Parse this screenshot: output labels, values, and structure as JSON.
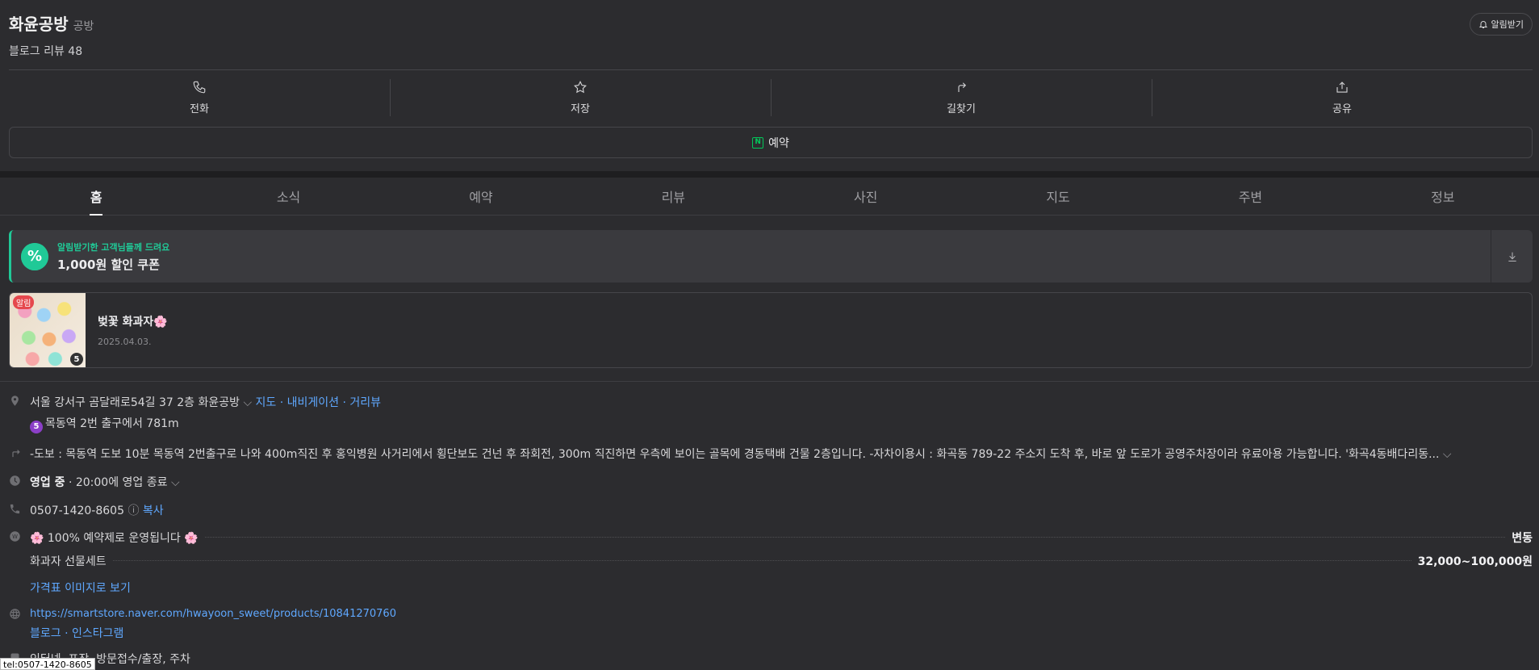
{
  "place": {
    "name": "화윤공방",
    "category": "공방",
    "blog_review": "블로그 리뷰 48",
    "alarm_label": "알림받기"
  },
  "actions": [
    {
      "label": "전화",
      "icon": "phone-icon"
    },
    {
      "label": "저장",
      "icon": "star-icon"
    },
    {
      "label": "길찾기",
      "icon": "directions-icon"
    },
    {
      "label": "공유",
      "icon": "share-icon"
    }
  ],
  "reserve_label": "예약",
  "npay_badge": "N",
  "tabs": [
    "홈",
    "소식",
    "예약",
    "리뷰",
    "사진",
    "지도",
    "주변",
    "정보"
  ],
  "coupon": {
    "sub": "알림받기한 고객님들께 드려요",
    "main": "1,000원 할인 쿠폰",
    "badge": "%"
  },
  "news": {
    "label": "알림",
    "count": "5",
    "title": "벚꽃 화과자🌸",
    "date": "2025.04.03."
  },
  "info": {
    "address": "서울 강서구 곰달래로54길 37 2층 화윤공방",
    "address_links": [
      "지도",
      "내비게이션",
      "거리뷰"
    ],
    "subway_line": "5",
    "subway_text": "목동역 2번 출구에서 781m",
    "directions": "-도보 : 목동역 도보 10분 목동역 2번출구로 나와 400m직진 후 홍익병원 사거리에서 횡단보도 건넌 후 좌회전, 300m 직진하면 우측에 보이는 골목에 경동택배 건물 2층입니다. -자차이용시 : 화곡동 789-22 주소지 도착 후, 바로 앞 도로가 공영주차장이라 유료아용 가능합니다. '화곡4동배다리동...",
    "hours_status": "영업 중",
    "hours_text": "· 20:00에 영업 종료",
    "phone": "0507-1420-8605",
    "copy_label": "복사",
    "menu": [
      {
        "name": "🌸 100% 예약제로 운영됩니다 🌸",
        "price": "변동"
      },
      {
        "name": "화과자 선물세트",
        "price": "32,000~100,000원"
      }
    ],
    "menu_image_link": "가격표 이미지로 보기",
    "website": "https://smartstore.naver.com/hwayoon_sweet/products/10841270760",
    "social_links": [
      "블로그",
      "인스타그램"
    ],
    "amenities": "인터넷, 포장, 방문접수/출장, 주차"
  },
  "status_bar": "tel:0507-1420-8605",
  "colors": {
    "background": "#2c2c2f",
    "accent_green": "#20c997",
    "link_blue": "#5fa8ff",
    "subway_purple": "#8b3fc7"
  }
}
